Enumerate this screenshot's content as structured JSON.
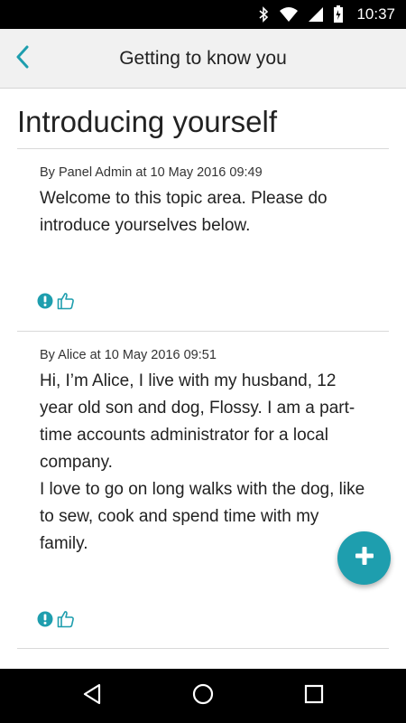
{
  "status_bar": {
    "time": "10:37",
    "icons": [
      "bluetooth-icon",
      "wifi-icon",
      "cell-signal-icon",
      "battery-icon"
    ]
  },
  "app_bar": {
    "back_icon": "chevron-left-icon",
    "title": "Getting to know you"
  },
  "page": {
    "title": "Introducing yourself"
  },
  "posts": [
    {
      "meta": "By Panel Admin at 10 May 2016 09:49",
      "paragraphs": [
        "Welcome to this topic area. Please do introduce yourselves below."
      ],
      "actions": [
        "report-icon",
        "thumbs-up-icon"
      ]
    },
    {
      "meta": "By Alice at 10 May 2016 09:51",
      "paragraphs": [
        "Hi, I’m Alice, I live with my husband, 12 year old son and dog, Flossy. I am a part-time accounts administrator for a local company.",
        "I love to go on long walks with the dog, like to sew, cook and spend time with my family."
      ],
      "actions": [
        "report-icon",
        "thumbs-up-icon"
      ]
    }
  ],
  "fab": {
    "icon": "plus-icon"
  },
  "nav_bar": {
    "icons": [
      "back-triangle-icon",
      "home-circle-icon",
      "recents-square-icon"
    ]
  },
  "colors": {
    "accent": "#1e9eae",
    "app_bar_bg": "#f1f1f1"
  }
}
